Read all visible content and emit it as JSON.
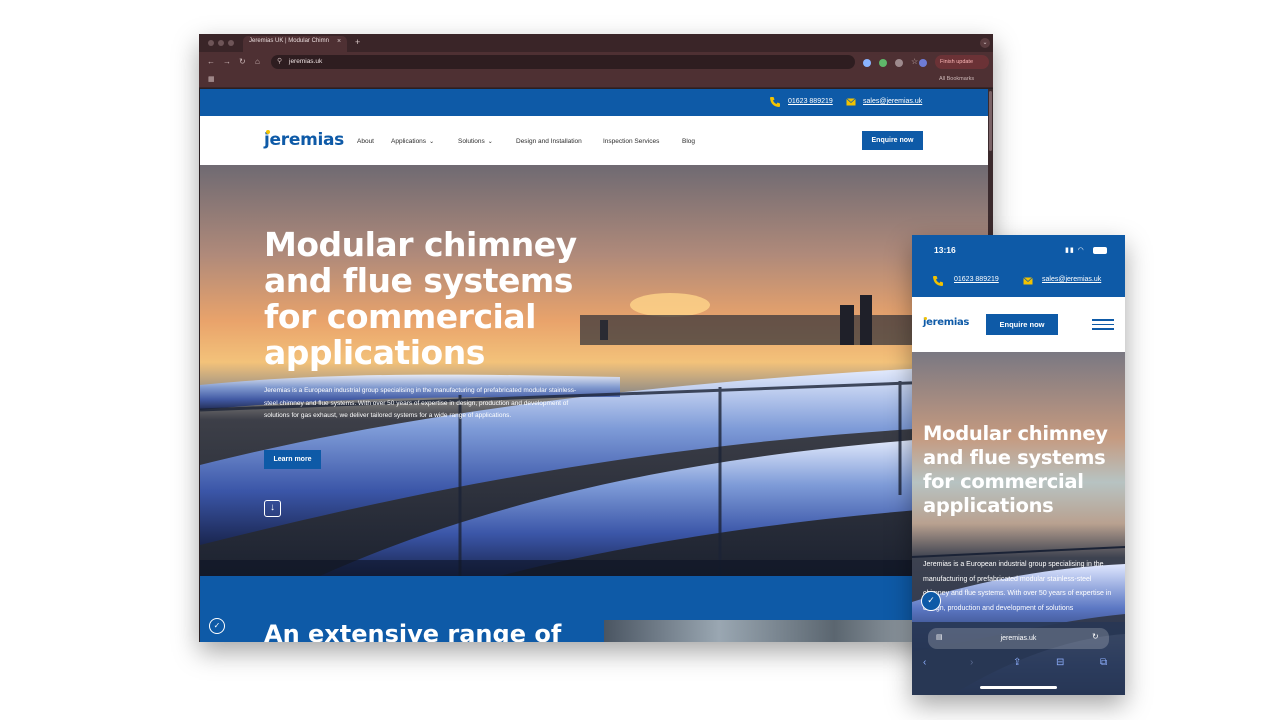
{
  "browser": {
    "tab_title": "Jeremias UK | Modular Chimn",
    "tab_close": "×",
    "new_tab": "+",
    "url": "jeremias.uk",
    "finish_update": "Finish update",
    "all_bookmarks": "All Bookmarks",
    "icons": [
      "back-icon",
      "forward-icon",
      "reload-icon",
      "home-icon",
      "star-icon",
      "extension-icon",
      "menu-icon"
    ]
  },
  "site": {
    "phone": "01623 889219",
    "email": "sales@jeremias.uk",
    "logo": "jeremias",
    "nav": {
      "about": "About",
      "applications": "Applications",
      "solutions": "Solutions",
      "design": "Design and Installation",
      "inspection": "Inspection Services",
      "blog": "Blog"
    },
    "enquire": "Enquire now",
    "hero_title": "Modular chimney and flue systems for commercial applications",
    "hero_body": "Jeremias is a European industrial group specialising in the manufacturing of prefabricated modular stainless-steel chimney and flue systems. With over 50 years of expertise in design, production and development of solutions for gas exhaust, we deliver tailored systems for a wide range of applications.",
    "learn_more": "Learn more",
    "section_title": "An extensive range of",
    "colors": {
      "brand_blue": "#0e5aa7",
      "logo_dot": "#f2c200"
    }
  },
  "mobile": {
    "time": "13:16",
    "phone": "01623 889219",
    "email": "sales@jeremias.uk",
    "logo": "jeremias",
    "enquire": "Enquire now",
    "hero_title": "Modular chimney and flue systems for commercial applications",
    "hero_body": "Jeremias is a European industrial group specialising in the manufacturing of prefabricated modular stainless-steel chimney and flue systems. With over 50 years of expertise in design, production and development of solutions",
    "url": "jeremias.uk"
  }
}
